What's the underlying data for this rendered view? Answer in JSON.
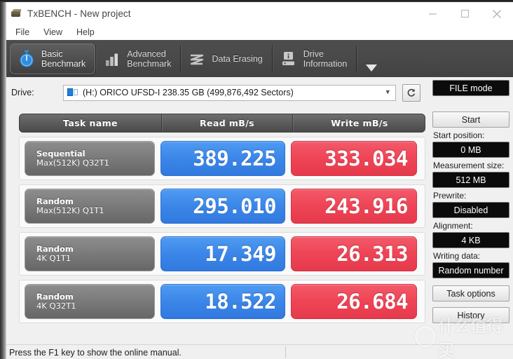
{
  "window": {
    "title": "TxBENCH - New project",
    "icon": "drive-icon",
    "controls": {
      "minimize": "minimize-icon",
      "maximize": "maximize-icon",
      "close": "close-icon"
    }
  },
  "menu": {
    "items": [
      {
        "label": "File"
      },
      {
        "label": "View"
      },
      {
        "label": "Help"
      }
    ]
  },
  "tabs": {
    "items": [
      {
        "label": "Basic\nBenchmark",
        "icon": "stopwatch-icon",
        "active": true
      },
      {
        "label": "Advanced\nBenchmark",
        "icon": "bar-chart-icon",
        "active": false
      },
      {
        "label": "Data Erasing",
        "icon": "shred-icon",
        "active": false
      },
      {
        "label": "Drive\nInformation",
        "icon": "drive-info-icon",
        "active": false
      }
    ],
    "overflow_icon": "chevron-down-icon"
  },
  "drive": {
    "label": "Drive:",
    "selected": "(H:) ORICO UFSD-I  238.35 GB (499,876,492 Sectors)",
    "dropdown_icon": "chevron-down-icon",
    "refresh_icon": "refresh-icon"
  },
  "results": {
    "headers": [
      "Task name",
      "Read mB/s",
      "Write mB/s"
    ],
    "rows": [
      {
        "task_line1": "Sequential",
        "task_line2": "Max(512K) Q32T1",
        "read": "389.225",
        "write": "333.034"
      },
      {
        "task_line1": "Random",
        "task_line2": "Max(512K) Q1T1",
        "read": "295.010",
        "write": "243.916"
      },
      {
        "task_line1": "Random",
        "task_line2": "4K Q1T1",
        "read": "17.349",
        "write": "26.313"
      },
      {
        "task_line1": "Random",
        "task_line2": "4K Q32T1",
        "read": "18.522",
        "write": "26.684"
      }
    ]
  },
  "sidebar": {
    "mode_button": "FILE mode",
    "start_button": "Start",
    "start_position_label": "Start position:",
    "start_position_value": "0 MB",
    "measurement_size_label": "Measurement size:",
    "measurement_size_value": "512 MB",
    "prewrite_label": "Prewrite:",
    "prewrite_value": "Disabled",
    "alignment_label": "Alignment:",
    "alignment_value": "4 KB",
    "writing_data_label": "Writing data:",
    "writing_data_value": "Random number",
    "task_options_button": "Task options",
    "history_button": "History"
  },
  "statusbar": {
    "message": "Press the F1 key to show the online manual."
  },
  "watermark": {
    "text": "什么值得买"
  },
  "colors": {
    "read_blue": "#3b86e8",
    "write_red": "#ee4455",
    "tab_strip": "#4a4a4a",
    "accent_icon_blue": "#2f8de0"
  }
}
